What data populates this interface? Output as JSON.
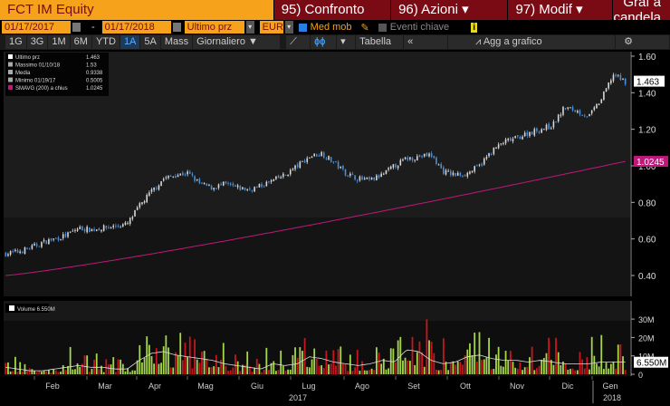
{
  "header": {
    "ticker": "FCT IM Equity",
    "compare": "95) Confronto",
    "actions": "96) Azioni",
    "modify": "97) Modif",
    "chart_type": "Graf a candela"
  },
  "controls": {
    "start_date": "01/17/2017",
    "dash": "-",
    "end_date": "01/17/2018",
    "field": "Ultimo prz",
    "currency": "EUR",
    "moving_avg": "Med mob",
    "key_events": "Eventi chiave",
    "info": "i"
  },
  "periods": [
    "1G",
    "3G",
    "1M",
    "6M",
    "YTD",
    "1A",
    "5A",
    "Mass"
  ],
  "active_period": "1A",
  "toolbar": {
    "frequency": "Giornaliero ▼",
    "table": "Tabella",
    "collapse": "«",
    "add_to_chart": "Agg a grafico",
    "settings": "⚙"
  },
  "legend": [
    {
      "label": "Ultimo prz",
      "value": "1.463"
    },
    {
      "label": "Massimo 01/10/18",
      "value": "1.53"
    },
    {
      "label": "Media",
      "value": "0.9338"
    },
    {
      "label": "Minimo 01/19/17",
      "value": "0.5005"
    },
    {
      "label": "SMAVG (200) a chius",
      "value": "1.0245"
    }
  ],
  "volume_legend": "Volume 6.550M",
  "colors": {
    "up": "#d8d8d8",
    "down": "#4a8fd8",
    "vol_up": "#a6d64a",
    "vol_down": "#c8161e",
    "smavg": "#c0187a",
    "accent": "#f7a21b"
  },
  "chart_data": {
    "type": "candlestick",
    "x_range": [
      "01/17/2017",
      "01/17/2018"
    ],
    "price_axis": {
      "ticks": [
        "1.60",
        "1.40",
        "1.20",
        "1.00",
        "0.80",
        "0.60",
        "0.40"
      ],
      "ylim": [
        0.4,
        1.6
      ]
    },
    "last_label": "1.463",
    "smavg_label": "1.0245",
    "weekly_close": [
      0.52,
      0.53,
      0.55,
      0.58,
      0.6,
      0.62,
      0.66,
      0.65,
      0.66,
      0.67,
      0.68,
      0.78,
      0.86,
      0.93,
      0.95,
      0.96,
      0.9,
      0.88,
      0.9,
      0.88,
      0.87,
      0.89,
      0.92,
      0.95,
      1.0,
      1.05,
      1.07,
      1.02,
      0.96,
      0.93,
      0.92,
      0.95,
      1.0,
      1.04,
      1.05,
      1.06,
      0.97,
      0.95,
      0.96,
      1.0,
      1.08,
      1.13,
      1.15,
      1.18,
      1.2,
      1.22,
      1.32,
      1.3,
      1.27,
      1.36,
      1.5,
      1.46
    ],
    "smavg_range": [
      0.4,
      1.0245
    ],
    "volume_axis": {
      "ticks": [
        "30M",
        "20M",
        "10M",
        "0"
      ],
      "ylim": [
        0,
        37
      ]
    },
    "volume_last_label": "6.550M",
    "weekly_volume_M": [
      4,
      3,
      2,
      2,
      3,
      4,
      5,
      4,
      4,
      3,
      3,
      8,
      12,
      13,
      11,
      10,
      9,
      8,
      6,
      5,
      4,
      3,
      6,
      5,
      6,
      10,
      9,
      7,
      6,
      5,
      6,
      8,
      7,
      14,
      13,
      8,
      6,
      7,
      10,
      11,
      9,
      8,
      8,
      7,
      8,
      7,
      6,
      6,
      6,
      7,
      7,
      7
    ],
    "months": [
      "Feb",
      "Mar",
      "Apr",
      "Mag",
      "Giu",
      "Lug",
      "Ago",
      "Set",
      "Ott",
      "Nov",
      "Dic",
      "Gen"
    ],
    "years": [
      "2017",
      "2018"
    ]
  }
}
